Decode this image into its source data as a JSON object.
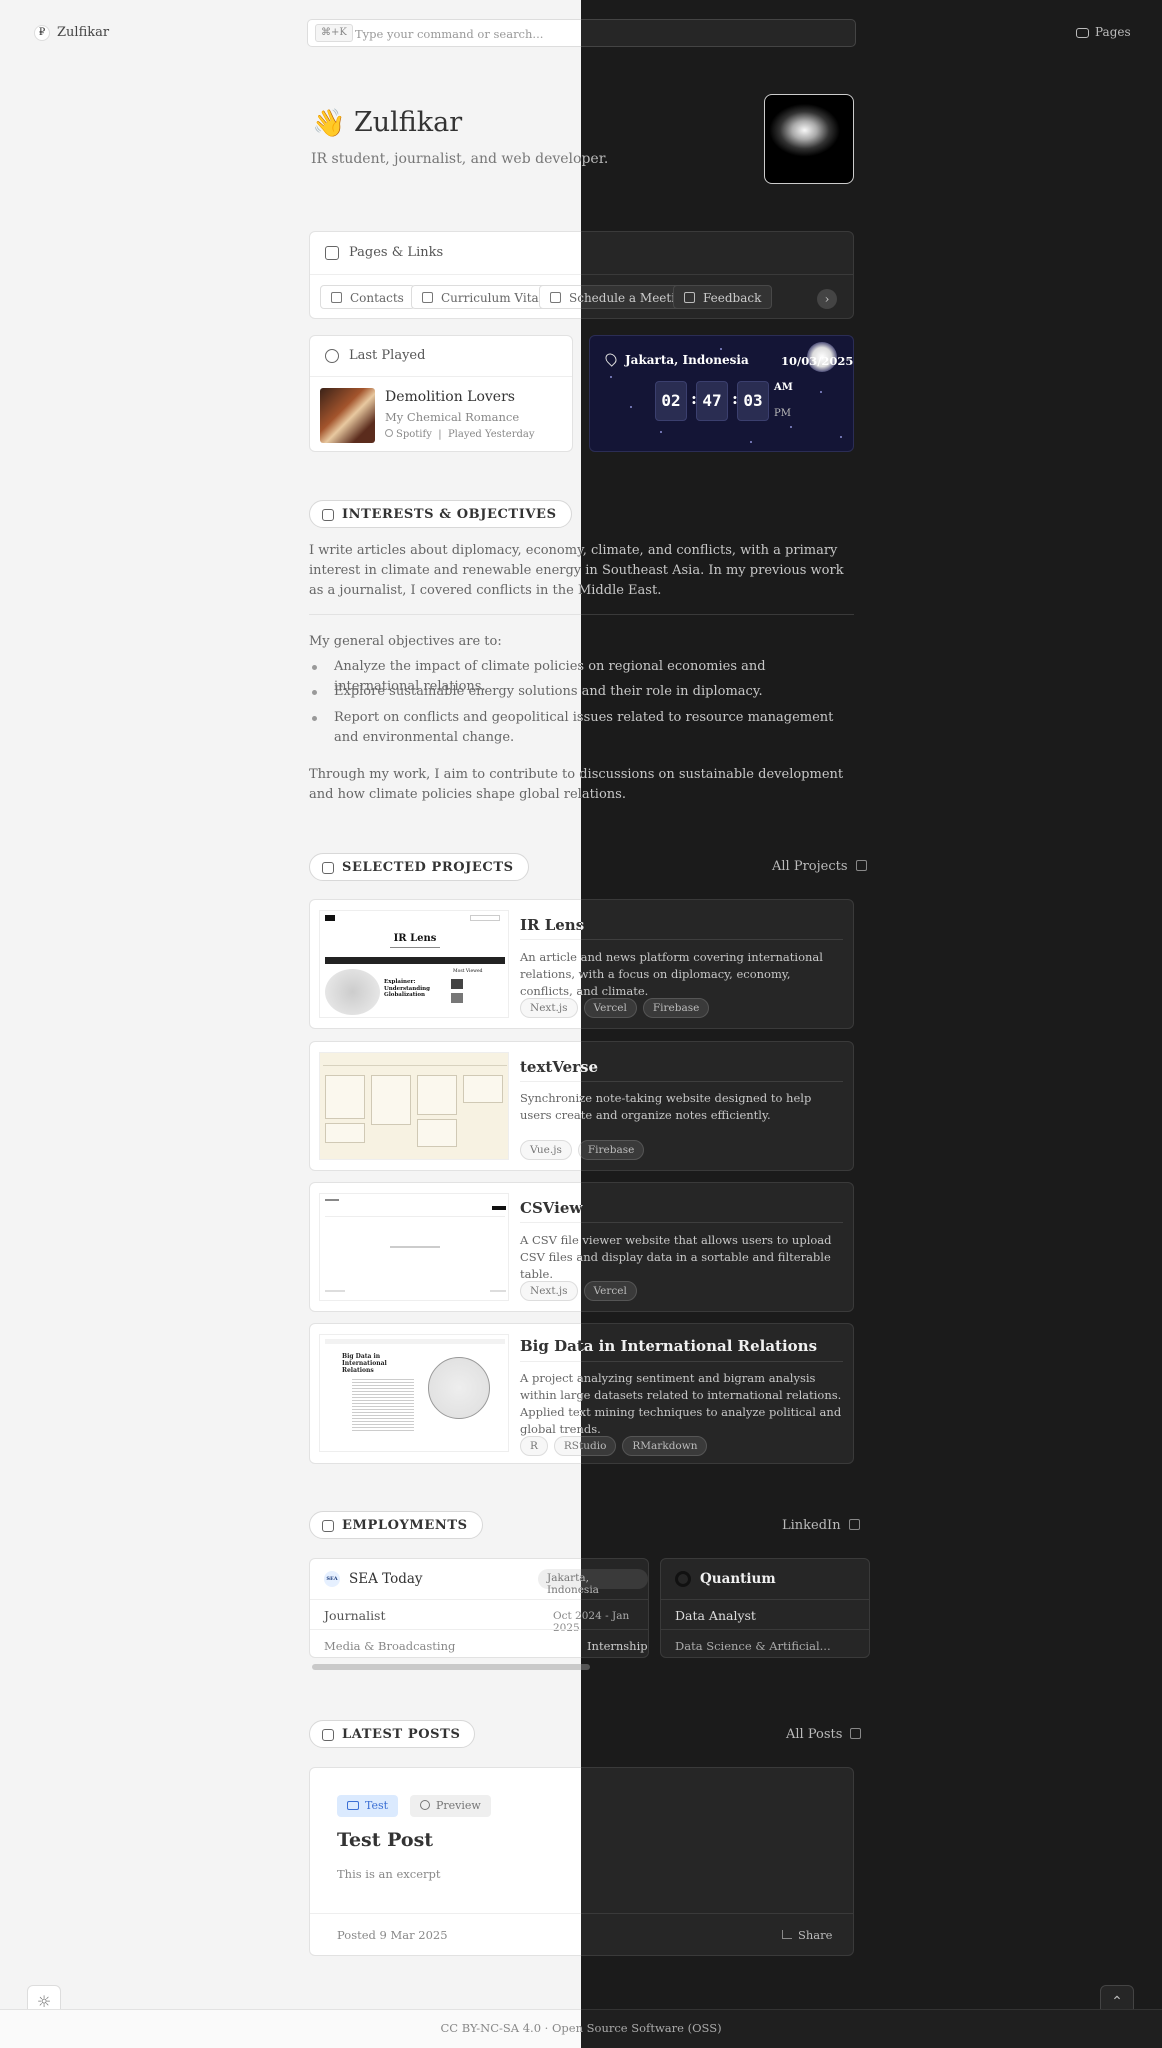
{
  "topbar": {
    "brand_mark": "₽",
    "brand": "Zulfikar",
    "search_shortcut": "⌘+K",
    "search_placeholder": "Type your command or search...",
    "pages_label": "Pages"
  },
  "hero": {
    "emoji": "👋",
    "name": "Zulfikar",
    "tagline": "IR student, journalist, and web developer."
  },
  "pages_links": {
    "title": "Pages & Links",
    "items": [
      "Contacts",
      "Curriculum Vitae",
      "Schedule a Meeting",
      "Feedback"
    ]
  },
  "last_played": {
    "title": "Last Played",
    "song": "Demolition Lovers",
    "artist": "My Chemical Romance",
    "source": "Spotify",
    "separator": "|",
    "when": "Played Yesterday"
  },
  "clock": {
    "location": "Jakarta, Indonesia",
    "date": "10/03/2025",
    "hours": "02",
    "minutes": "47",
    "seconds": "03",
    "am": "AM",
    "pm": "PM"
  },
  "interests": {
    "heading": "INTERESTS & OBJECTIVES",
    "intro": "I write articles about diplomacy, economy, climate, and conflicts, with a primary interest in climate and renewable energy in Southeast Asia. In my previous work as a journalist, I covered conflicts in the Middle East.",
    "objectives_lead": "My general objectives are to:",
    "objectives": [
      "Analyze the impact of climate policies on regional economies and international relations.",
      "Explore sustainable energy solutions and their role in diplomacy.",
      "Report on conflicts and geopolitical issues related to resource management and environmental change."
    ],
    "closing": "Through my work, I aim to contribute to discussions on sustainable development and how climate policies shape global relations."
  },
  "projects": {
    "heading": "SELECTED PROJECTS",
    "all_label": "All Projects",
    "items": [
      {
        "title": "IR Lens",
        "desc": "An article and news platform covering international relations, with a focus on diplomacy, economy, conflicts, and climate.",
        "tags": [
          "Next.js",
          "Vercel",
          "Firebase"
        ],
        "thumb_title": "IR Lens",
        "thumb_sub": "Explainer: Understanding Globalization",
        "thumb_side": "Most Viewed"
      },
      {
        "title": "textVerse",
        "desc": "Synchronize note-taking website designed to help users create and organize notes efficiently.",
        "tags": [
          "Vue.js",
          "Firebase"
        ]
      },
      {
        "title": "CSView",
        "desc": "A CSV file viewer website that allows users to upload CSV files and display data in a sortable and filterable table.",
        "tags": [
          "Next.js",
          "Vercel"
        ]
      },
      {
        "title": "Big Data in International Relations",
        "desc": "A project analyzing sentiment and bigram analysis within large datasets related to international relations. Applied text mining techniques to analyze political and global trends.",
        "tags": [
          "R",
          "RStudio",
          "RMarkdown"
        ],
        "thumb_title": "Big Data in International Relations"
      }
    ]
  },
  "employments": {
    "heading": "EMPLOYMENTS",
    "link_label": "LinkedIn",
    "items": [
      {
        "company": "SEA Today",
        "logo": "SEA",
        "location": "Jakarta, Indonesia",
        "role": "Journalist",
        "period": "Oct 2024 - Jan 2025",
        "industry": "Media & Broadcasting",
        "type": "Internship"
      },
      {
        "company": "Quantium",
        "role": "Data Analyst",
        "industry": "Data Science & Artificial..."
      }
    ]
  },
  "posts": {
    "heading": "LATEST POSTS",
    "all_label": "All Posts",
    "items": [
      {
        "category": "Test",
        "preview": "Preview",
        "title": "Test Post",
        "excerpt": "This is an excerpt",
        "date": "Posted 9 Mar 2025",
        "share": "Share"
      }
    ]
  },
  "footer": {
    "license": "CC BY-NC-SA 4.0 · Open Source Software (OSS)"
  },
  "colors": {
    "light_bg": "#f4f4f4",
    "dark_bg": "#1b1b1b",
    "clock_bg": "#141536",
    "accent_blue": "#dbeafe"
  },
  "icons": [
    "theme-toggle-sun-icon",
    "scroll-top-chevron-icon",
    "folder-icon",
    "cube-icon",
    "music-note-icon",
    "map-pin-icon",
    "external-link-icon",
    "briefcase-icon"
  ]
}
